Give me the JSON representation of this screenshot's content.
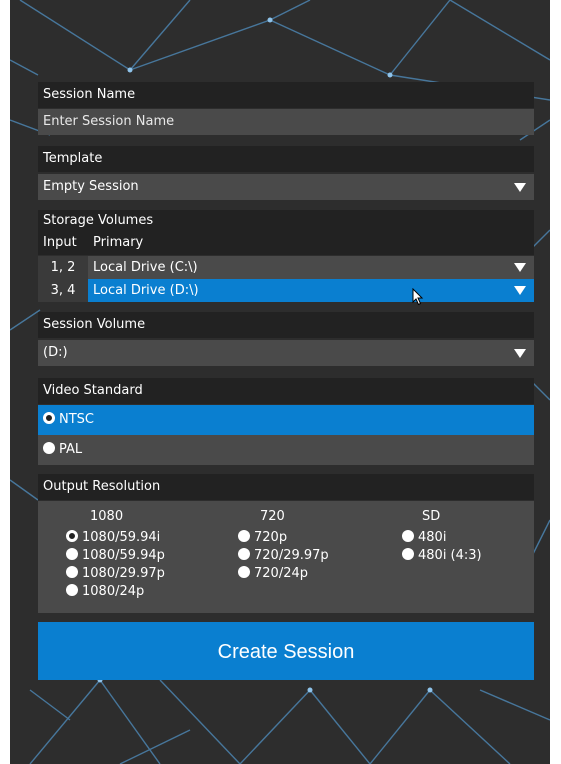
{
  "session_name": {
    "header": "Session Name",
    "placeholder": "Enter Session Name"
  },
  "template": {
    "header": "Template",
    "value": "Empty Session"
  },
  "storage": {
    "header": "Storage Volumes",
    "col_input": "Input",
    "col_primary": "Primary",
    "rows": [
      {
        "input": "1, 2",
        "drive": "Local Drive (C:\\)",
        "selected": false
      },
      {
        "input": "3, 4",
        "drive": "Local Drive (D:\\)",
        "selected": true
      }
    ]
  },
  "session_volume": {
    "header": "Session Volume",
    "value": "(D:)"
  },
  "video_standard": {
    "header": "Video Standard",
    "options": [
      {
        "label": "NTSC",
        "checked": true
      },
      {
        "label": "PAL",
        "checked": false
      }
    ]
  },
  "output_resolution": {
    "header": "Output Resolution",
    "groups": [
      {
        "title": "1080",
        "options": [
          "1080/59.94i",
          "1080/59.94p",
          "1080/29.97p",
          "1080/24p"
        ]
      },
      {
        "title": "720",
        "options": [
          "720p",
          "720/29.97p",
          "720/24p"
        ]
      },
      {
        "title": "SD",
        "options": [
          "480i",
          "480i (4:3)"
        ]
      }
    ],
    "selected": "1080/59.94i"
  },
  "create_button": "Create Session",
  "colors": {
    "accent": "#0a7fd0",
    "header_bg": "#222222",
    "field_bg": "#4a4a4a",
    "page_bg": "#2d2d2d"
  },
  "icons": [
    "dropdown-arrow-icon",
    "radio-icon",
    "mouse-cursor-icon"
  ]
}
